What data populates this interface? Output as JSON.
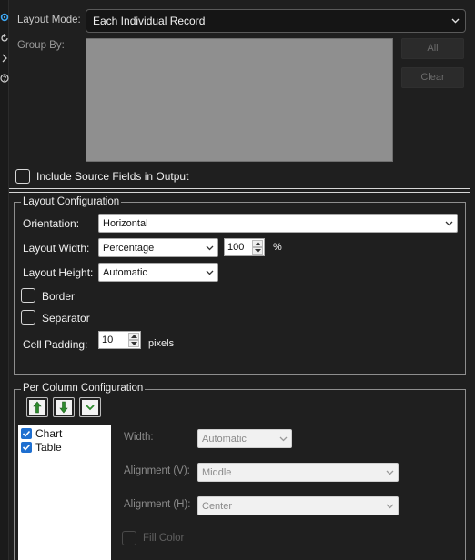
{
  "header": {
    "layout_mode_label": "Layout Mode:",
    "layout_mode_value": "Each Individual Record",
    "group_by_label": "Group By:",
    "all_button": "All",
    "clear_button": "Clear",
    "include_source_label": "Include Source Fields in Output",
    "include_source_checked": false
  },
  "side_icons": [
    "gear-icon",
    "refresh-icon",
    "chevron-right-icon",
    "help-icon"
  ],
  "layout_config": {
    "legend": "Layout Configuration",
    "orientation_label": "Orientation:",
    "orientation_value": "Horizontal",
    "width_label": "Layout Width:",
    "width_mode": "Percentage",
    "width_value": "100",
    "width_unit": "%",
    "height_label": "Layout Height:",
    "height_value": "Automatic",
    "border_label": "Border",
    "border_checked": false,
    "separator_label": "Separator",
    "separator_checked": false,
    "padding_label": "Cell Padding:",
    "padding_value": "10",
    "padding_unit": "pixels"
  },
  "column_config": {
    "legend": "Per Column Configuration",
    "toolbar": [
      "move-up-icon",
      "move-down-icon",
      "check-dropdown-icon"
    ],
    "columns": [
      {
        "label": "Chart",
        "checked": true
      },
      {
        "label": "Table",
        "checked": true
      }
    ],
    "width_label": "Width:",
    "width_value": "Automatic",
    "align_v_label": "Alignment (V):",
    "align_v_value": "Middle",
    "align_h_label": "Alignment (H):",
    "align_h_value": "Center",
    "fill_color_label": "Fill Color",
    "fill_color_checked": false
  },
  "colors": {
    "background": "#1f1f1f",
    "accent_icon": "#3fa9f5",
    "checkbox_checked": "#1e6fd0",
    "arrow_green": "#2e8b2e"
  }
}
